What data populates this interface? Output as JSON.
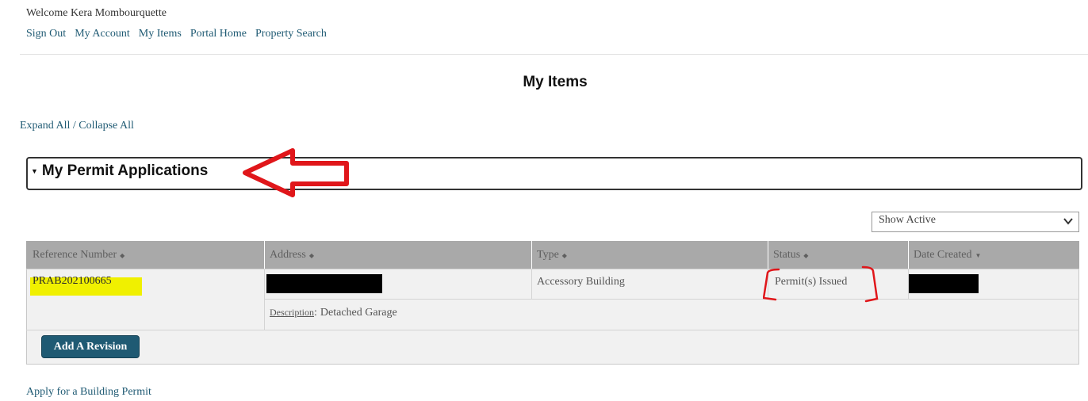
{
  "header": {
    "welcome": "Welcome Kera Mombourquette",
    "nav": [
      "Sign Out",
      "My Account",
      "My Items",
      "Portal Home",
      "Property Search"
    ]
  },
  "page": {
    "title": "My Items",
    "expand_collapse": "Expand All / Collapse All",
    "section_title": "My Permit Applications"
  },
  "filter": {
    "selected": "Show Active"
  },
  "table": {
    "columns": [
      "Reference Number",
      "Address",
      "Type",
      "Status",
      "Date Created"
    ],
    "row": {
      "reference": "PRAB202100665",
      "type": "Accessory Building",
      "status": "Permit(s) Issued",
      "description_label": "Description",
      "description_value": "Detached Garage"
    }
  },
  "actions": {
    "add_revision": "Add A Revision",
    "apply_permit": "Apply for a Building Permit"
  },
  "colors": {
    "link": "#1f5a73",
    "header_bg": "#a9a9a9",
    "button_bg": "#1f5a73",
    "annotation_red": "#e0161a",
    "highlight": "#f0f000"
  }
}
